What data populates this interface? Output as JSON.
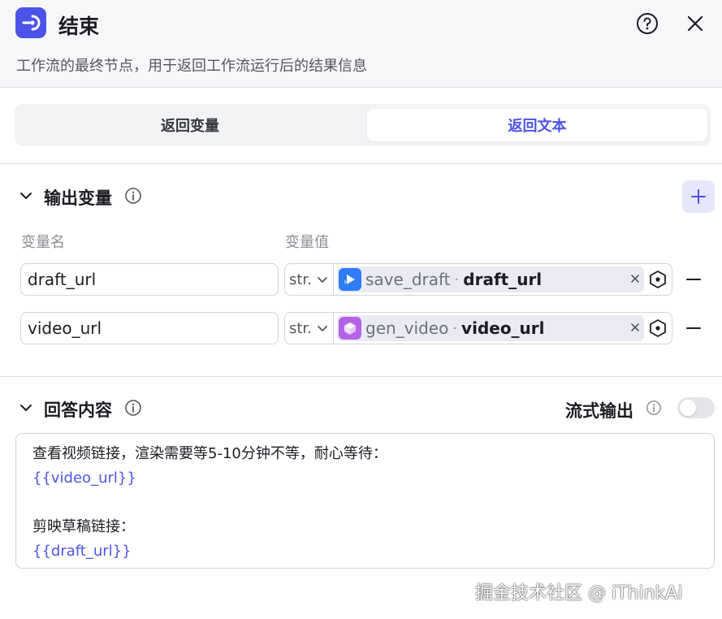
{
  "header": {
    "title": "结束",
    "description": "工作流的最终节点，用于返回工作流运行后的结果信息",
    "icons": {
      "node": "end-node-icon",
      "help": "help-icon",
      "close": "close-icon"
    }
  },
  "tabs": [
    {
      "label": "返回变量",
      "active": false
    },
    {
      "label": "返回文本",
      "active": true
    }
  ],
  "output_section": {
    "title": "输出变量",
    "col_name": "变量名",
    "col_value": "变量值",
    "rows": [
      {
        "name": "draft_url",
        "type": "str.",
        "node": "save_draft",
        "sep": "·",
        "var": "draft_url",
        "node_icon": "play-node-icon",
        "icon_color": "#2f7cf6"
      },
      {
        "name": "video_url",
        "type": "str.",
        "node": "gen_video",
        "sep": "·",
        "var": "video_url",
        "node_icon": "cube-node-icon",
        "icon_color": "#b462e8"
      }
    ]
  },
  "answer_section": {
    "title": "回答内容",
    "stream_label": "流式输出",
    "stream_enabled": false,
    "content": {
      "line1": "查看视频链接，渲染需要等5-10分钟不等，耐心等待：",
      "line2": "{{video_url}}",
      "line3": "剪映草稿链接：",
      "line4": "{{draft_url}}"
    }
  },
  "watermark": "掘金技术社区 @ iThinkAi",
  "colors": {
    "accent": "#4d53e8",
    "header_bg": "#f7f7fa"
  }
}
